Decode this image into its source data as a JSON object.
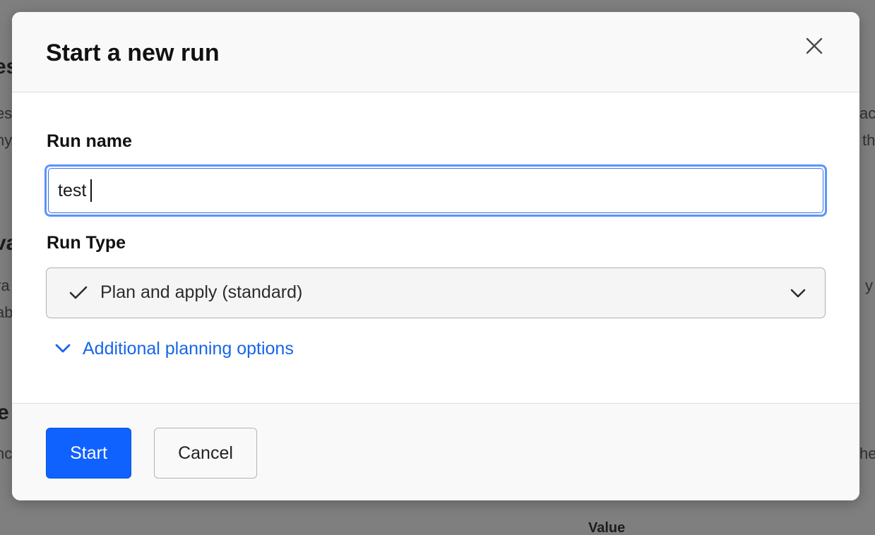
{
  "background": {
    "fragments": [
      {
        "text": "es"
      },
      {
        "text": "es"
      },
      {
        "text": "ny"
      },
      {
        "text": "va"
      },
      {
        "text": "ra"
      },
      {
        "text": "ab"
      },
      {
        "text": "e"
      },
      {
        "text": "nc"
      },
      {
        "text": "ac"
      },
      {
        "text": "th"
      },
      {
        "text": "y"
      },
      {
        "text": "he"
      },
      {
        "text": "Value"
      }
    ]
  },
  "modal": {
    "title": "Start a new run",
    "close_icon": "close-icon",
    "fields": {
      "run_name": {
        "label": "Run name",
        "value": "test"
      },
      "run_type": {
        "label": "Run Type",
        "selected": "Plan and apply (standard)",
        "check_icon": "checkmark-icon",
        "chevron_icon": "chevron-down-icon"
      }
    },
    "disclosure": {
      "label": "Additional planning options",
      "icon": "chevron-down-icon"
    },
    "footer": {
      "start_label": "Start",
      "cancel_label": "Cancel"
    }
  },
  "colors": {
    "primary": "#0f62fe",
    "link": "#1766e8",
    "focus_ring": "#5b93ff",
    "backdrop": "#7f7f7f"
  }
}
